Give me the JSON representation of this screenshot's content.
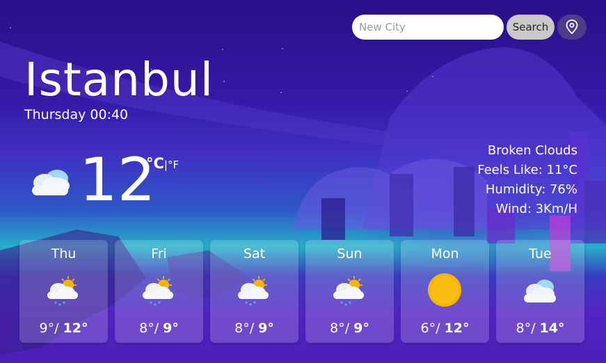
{
  "search": {
    "placeholder": "New City",
    "button_label": "Search"
  },
  "location_icon": "map-pin-icon",
  "current": {
    "city": "Istanbul",
    "datetime": "Thursday 00:40",
    "temp": "12",
    "unit_c": "°C",
    "unit_sep": "|",
    "unit_f": "°F",
    "icon": "cloud-icon",
    "description": "Broken Clouds",
    "feels_like": "Feels Like: 11°C",
    "humidity": "Humidity: 76%",
    "wind": "Wind: 3Km/H"
  },
  "forecast": [
    {
      "day": "Thu",
      "icon": "sun-cloud-rain-icon",
      "min": "9°/",
      "max": "12°"
    },
    {
      "day": "Fri",
      "icon": "sun-cloud-rain-icon",
      "min": "8°/",
      "max": "9°"
    },
    {
      "day": "Sat",
      "icon": "sun-cloud-rain-icon",
      "min": "8°/",
      "max": "9°"
    },
    {
      "day": "Sun",
      "icon": "sun-cloud-rain-icon",
      "min": "8°/",
      "max": "9°"
    },
    {
      "day": "Mon",
      "icon": "sun-icon",
      "min": "6°/",
      "max": "12°"
    },
    {
      "day": "Tue",
      "icon": "cloud-icon",
      "min": "8°/",
      "max": "14°"
    }
  ],
  "colors": {
    "search_button": "#c9c9c9",
    "location_button": "#4e3c8a",
    "sun": "#f7b500"
  }
}
